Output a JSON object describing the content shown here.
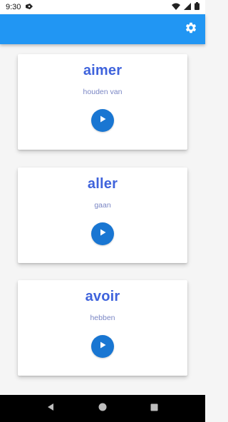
{
  "status_bar": {
    "time": "9:30",
    "icons": [
      "notification-icon",
      "wifi-icon",
      "signal-icon",
      "battery-icon"
    ]
  },
  "app_bar": {
    "background": "#2196f3",
    "actions": [
      {
        "icon": "gear-icon"
      }
    ]
  },
  "cards": [
    {
      "word": "aimer",
      "translation": "houden van",
      "action_icon": "play-icon"
    },
    {
      "word": "aller",
      "translation": "gaan",
      "action_icon": "play-icon"
    },
    {
      "word": "avoir",
      "translation": "hebben",
      "action_icon": "play-icon"
    }
  ],
  "colors": {
    "word": "#3f63dc",
    "translation": "#7a86c4",
    "play_button": "#1976d2"
  },
  "nav_bar": {
    "buttons": [
      "back-icon",
      "home-icon",
      "recents-icon"
    ]
  }
}
